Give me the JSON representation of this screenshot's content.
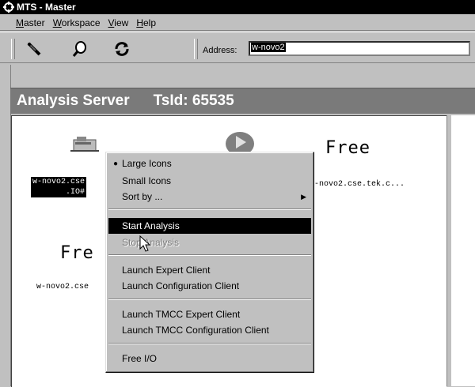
{
  "window": {
    "title": "MTS - Master"
  },
  "menubar": {
    "items": [
      {
        "label": "aster",
        "mnemonic": "M"
      },
      {
        "label": "orkspace",
        "mnemonic": "W"
      },
      {
        "label": "iew",
        "mnemonic": "V"
      },
      {
        "label": "elp",
        "mnemonic": "H"
      }
    ]
  },
  "toolbar": {
    "address_label": "Address:",
    "address_value": "w-novo2",
    "icons": [
      "probe-icon",
      "magnifier-icon",
      "refresh-icon"
    ]
  },
  "header": {
    "title": "Analysis Server",
    "tsid": "TsId: 65535"
  },
  "pane": {
    "items": [
      {
        "label_line1": "w-novo2.cse",
        "label_line2": ".IO#",
        "selected": true
      },
      {
        "label": "Free"
      },
      {
        "label": "w-novo2.cse.tek.c..."
      },
      {
        "label": "Fre"
      },
      {
        "label": "w-novo2.cse"
      }
    ]
  },
  "context_menu": {
    "items": [
      {
        "label": "Large Icons",
        "checked": true
      },
      {
        "label": "Small Icons"
      },
      {
        "label": "Sort by ...",
        "submenu": true
      },
      {
        "label": "Start Analysis",
        "highlighted": true
      },
      {
        "label": "Stop Analysis",
        "disabled": true
      },
      {
        "label": "Launch Expert Client"
      },
      {
        "label": "Launch Configuration Client"
      },
      {
        "label": "Launch TMCC Expert Client"
      },
      {
        "label": "Launch TMCC Configuration Client"
      },
      {
        "label": "Free I/O"
      }
    ]
  }
}
